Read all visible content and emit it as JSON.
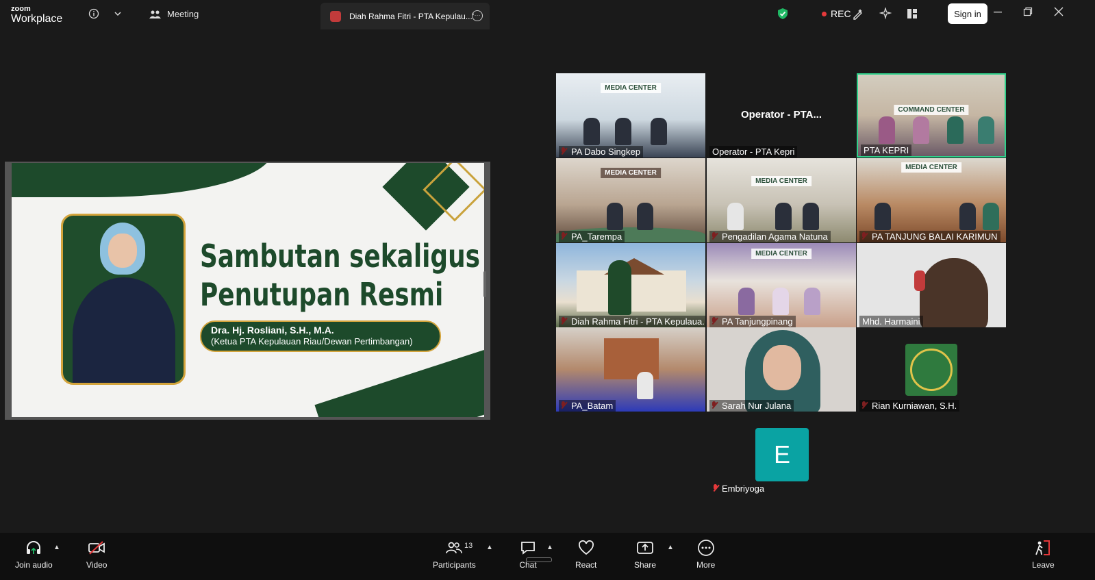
{
  "topbar": {
    "logo_line1": "zoom",
    "logo_line2": "Workplace",
    "meeting_tab": "Meeting",
    "active_tab": "Diah Rahma Fitri - PTA Kepulau...'",
    "rec_label": "REC",
    "signin_label": "Sign in"
  },
  "slide": {
    "title_line1": "Sambutan sekaligus",
    "title_line2": "Penutupan Resmi",
    "speaker_name": "Dra. Hj. Rosliani, S.H., M.A.",
    "speaker_role": "(Ketua PTA Kepulauan Riau/Dewan Pertimbangan)"
  },
  "tiles": [
    {
      "label": "PA Dabo Singkep",
      "muted": true,
      "sign": "MEDIA CENTER"
    },
    {
      "label": "Operator - PTA Kepri",
      "muted": false,
      "center": "Operator - PTA..."
    },
    {
      "label": "PTA KEPRI",
      "muted": false,
      "sign": "COMMAND CENTER",
      "active": true
    },
    {
      "label": "PA_Tarempa",
      "muted": true,
      "sign": "MEDIA CENTER"
    },
    {
      "label": "Pengadilan Agama Natuna",
      "muted": true,
      "sign": "MEDIA CENTER"
    },
    {
      "label": "PA TANJUNG BALAI KARIMUN",
      "muted": true,
      "sign": "MEDIA CENTER"
    },
    {
      "label": "Diah Rahma Fitri - PTA Kepulaua...",
      "muted": true
    },
    {
      "label": "PA Tanjungpinang",
      "muted": true,
      "sign": "MEDIA CENTER"
    },
    {
      "label": "Mhd. Harmaini",
      "muted": false
    },
    {
      "label": "PA_Batam",
      "muted": true
    },
    {
      "label": "Sarah Nur Julana",
      "muted": true
    },
    {
      "label": "Rian Kurniawan, S.H.",
      "muted": true
    }
  ],
  "extra_participant": {
    "initial": "E",
    "label": "Embriyoga"
  },
  "toolbar": {
    "join_audio": "Join audio",
    "video": "Video",
    "participants": "Participants",
    "participants_count": "13",
    "chat": "Chat",
    "react": "React",
    "share": "Share",
    "more": "More",
    "leave": "Leave"
  },
  "colors": {
    "accent_green": "#1d4a2b",
    "gold": "#d3a43c",
    "rec_red": "#e5393b",
    "avatar_teal": "#0aa3a3",
    "active_border": "#2fd08a"
  }
}
